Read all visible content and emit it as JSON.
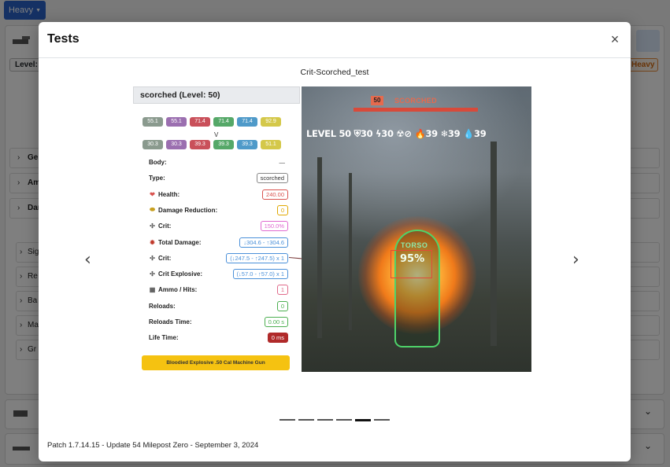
{
  "background": {
    "heavy_button_label": "Heavy",
    "level_label": "Level:",
    "heavy_badge": "Heavy",
    "accordions": [
      "Ger",
      "Am",
      "Dar"
    ],
    "sub_accordions": [
      "Sig",
      "Re",
      "Ba",
      "Ma",
      "Gr"
    ]
  },
  "modal": {
    "title": "Tests",
    "close_label": "×",
    "image_caption": "Crit-Scorched_test",
    "prev_label": "‹",
    "next_label": "›",
    "indicator_count": 6,
    "active_indicator": 5,
    "patch_text": "Patch 1.7.14.15 - Update 54 Milepost Zero - September 3, 2024"
  },
  "stat_panel": {
    "header": "scorched (Level: 50)",
    "resist_row_1": [
      "55.1",
      "55.1",
      "71.4",
      "71.4",
      "71.4",
      "92.9"
    ],
    "vs": "V",
    "resist_row_2": [
      "30.3",
      "30.3",
      "39.3",
      "39.3",
      "39.3",
      "51.1"
    ],
    "resist_colors": [
      "#8a9a8e",
      "#9b6fb0",
      "#c9505a",
      "#55a868",
      "#4f9ac9",
      "#d4c84a"
    ],
    "rows": [
      {
        "label": "Body:",
        "value": "—",
        "icon": "",
        "color": "#aaaaaa"
      },
      {
        "label": "Type:",
        "value": "scorched",
        "icon": "",
        "color": "#888888"
      },
      {
        "label": "Health:",
        "value": "240.00",
        "icon": "heart-icon",
        "color": "#d9534f"
      },
      {
        "label": "Damage Reduction:",
        "value": "0",
        "icon": "shield-icon",
        "color": "#e0a800"
      },
      {
        "label": "Crit:",
        "value": "150.0%",
        "icon": "crosshair-icon",
        "color": "#e06ad0"
      },
      {
        "label": "Total Damage:",
        "value": "↓304.6 - ↑304.6",
        "icon": "explosion-icon",
        "color": "#4a90d9"
      },
      {
        "label": "Crit:",
        "value": "(↓247.5 - ↑247.5) x 1",
        "icon": "crosshair-icon",
        "color": "#4a90d9"
      },
      {
        "label": "Crit Explosive:",
        "value": "(↓57.0 - ↑57.0) x 1",
        "icon": "crosshair-icon",
        "color": "#4a90d9"
      },
      {
        "label": "Ammo / Hits:",
        "value": "1",
        "icon": "ammo-icon",
        "color": "#e06a8a"
      },
      {
        "label": "Reloads:",
        "value": "0",
        "icon": "",
        "color": "#4caf50"
      },
      {
        "label": "Reloads Time:",
        "value": "0.00 s",
        "icon": "",
        "color": "#4caf50"
      },
      {
        "label": "Life Time:",
        "value": "0 ms",
        "icon": "",
        "color": "#b02a2a"
      }
    ],
    "weapon": "Bloodied Explosive .50 Cal Machine Gun"
  },
  "game": {
    "enemy_level": "50",
    "enemy_name": "SCORCHED",
    "level_line": "LEVEL 50 ⛨30 ϟ30 ☢⊘ 🔥39 ❄39 💧39",
    "torso_label": "TORSO",
    "hit_chance": "95%"
  }
}
